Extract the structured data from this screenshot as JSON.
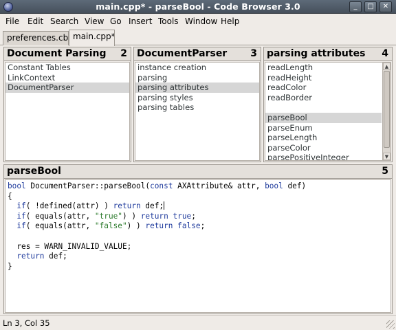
{
  "window": {
    "title": "main.cpp* - parseBool - Code Browser 3.0",
    "minimize_glyph": "_",
    "maximize_glyph": "□",
    "close_glyph": "✕"
  },
  "menu": [
    "File",
    "Edit",
    "Search",
    "View",
    "Go",
    "Insert",
    "Tools",
    "Window",
    "Help"
  ],
  "tabs": [
    "preferences.cbc",
    "main.cpp*"
  ],
  "panels": [
    {
      "title": "Document Parsing",
      "number": "2",
      "items": [
        "Constant Tables",
        "LinkContext",
        "DocumentParser"
      ]
    },
    {
      "title": "DocumentParser",
      "number": "3",
      "items": [
        "instance creation",
        "parsing",
        "parsing attributes",
        "parsing styles",
        "parsing tables"
      ]
    },
    {
      "title": "parsing attributes",
      "number": "4",
      "items": [
        "readLength",
        "readHeight",
        "readColor",
        "readBorder",
        "",
        "parseBool",
        "parseEnum",
        "parseLength",
        "parseColor",
        "parsePositiveInteger"
      ]
    }
  ],
  "editor": {
    "title": "parseBool",
    "number": "5",
    "lines": [
      {
        "parts": [
          {
            "t": "bool",
            "k": "kw"
          },
          {
            "t": " DocumentParser::parseBool(",
            "k": ""
          },
          {
            "t": "const",
            "k": "kw"
          },
          {
            "t": " AXAttribute& attr, ",
            "k": ""
          },
          {
            "t": "bool",
            "k": "kw"
          },
          {
            "t": " def)",
            "k": ""
          }
        ]
      },
      {
        "parts": [
          {
            "t": "{",
            "k": ""
          }
        ]
      },
      {
        "parts": [
          {
            "t": "  ",
            "k": ""
          },
          {
            "t": "if",
            "k": "kw"
          },
          {
            "t": "( !defined(attr) ) ",
            "k": ""
          },
          {
            "t": "return",
            "k": "kw"
          },
          {
            "t": " def;",
            "k": ""
          }
        ],
        "cursor": true
      },
      {
        "parts": [
          {
            "t": "  ",
            "k": ""
          },
          {
            "t": "if",
            "k": "kw"
          },
          {
            "t": "( equals(attr, ",
            "k": ""
          },
          {
            "t": "\"true\"",
            "k": "str"
          },
          {
            "t": ") ) ",
            "k": ""
          },
          {
            "t": "return",
            "k": "kw"
          },
          {
            "t": " ",
            "k": ""
          },
          {
            "t": "true",
            "k": "kw"
          },
          {
            "t": ";",
            "k": ""
          }
        ]
      },
      {
        "parts": [
          {
            "t": "  ",
            "k": ""
          },
          {
            "t": "if",
            "k": "kw"
          },
          {
            "t": "( equals(attr, ",
            "k": ""
          },
          {
            "t": "\"false\"",
            "k": "str"
          },
          {
            "t": ") ) ",
            "k": ""
          },
          {
            "t": "return",
            "k": "kw"
          },
          {
            "t": " ",
            "k": ""
          },
          {
            "t": "false",
            "k": "kw"
          },
          {
            "t": ";",
            "k": ""
          }
        ]
      },
      {
        "parts": [
          {
            "t": "",
            "k": ""
          }
        ]
      },
      {
        "parts": [
          {
            "t": "  res = WARN_INVALID_VALUE;",
            "k": ""
          }
        ]
      },
      {
        "parts": [
          {
            "t": "  ",
            "k": ""
          },
          {
            "t": "return",
            "k": "kw"
          },
          {
            "t": " def;",
            "k": ""
          }
        ]
      },
      {
        "parts": [
          {
            "t": "}",
            "k": ""
          }
        ]
      }
    ]
  },
  "status": "Ln 3, Col 35",
  "colors": {
    "keyword": "#1e3a9c",
    "string": "#2c7a2c",
    "selection": "#d6d6d6"
  }
}
